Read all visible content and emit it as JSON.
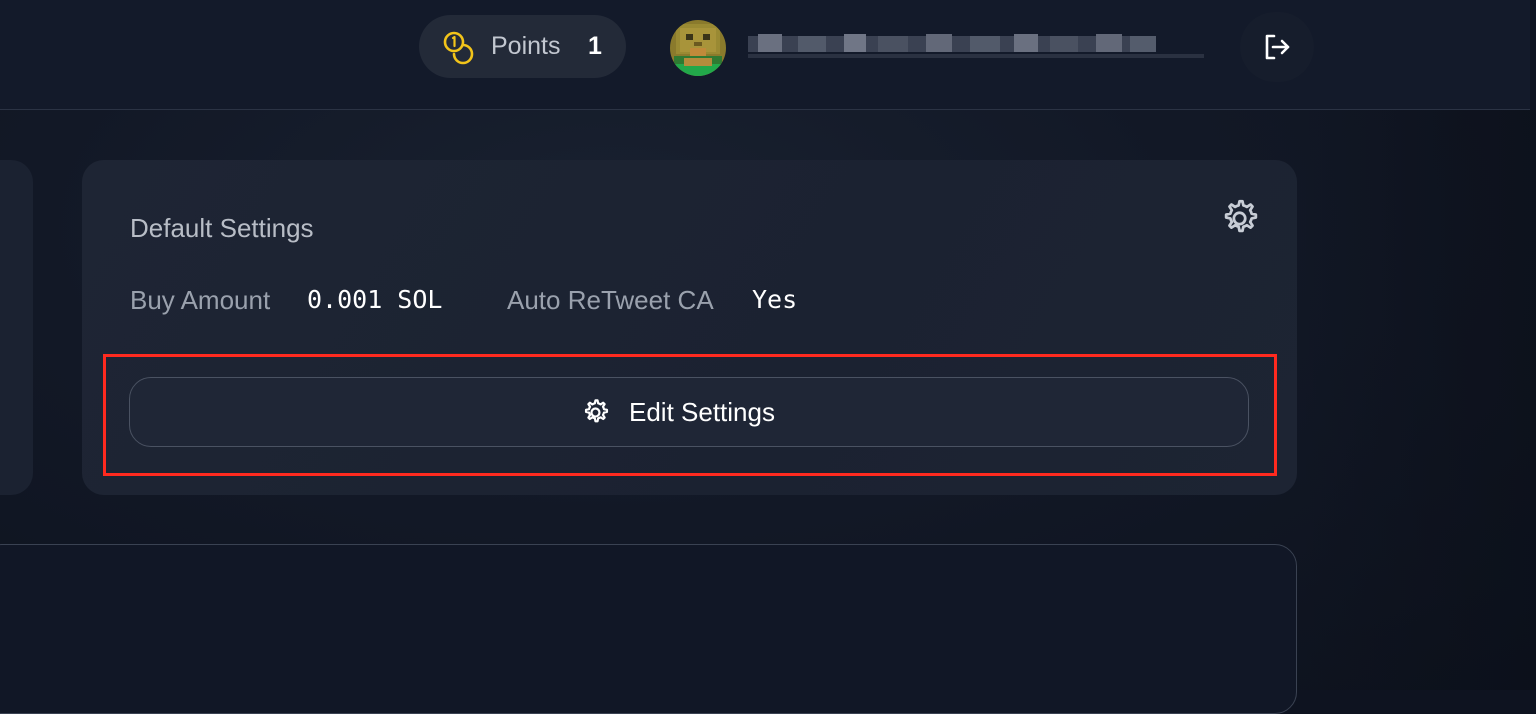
{
  "header": {
    "points_label": "Points",
    "points_value": "1",
    "points_icon": "coins-icon",
    "avatar_icon": "pixel-avatar",
    "username_redacted": true,
    "logout_icon": "logout-icon"
  },
  "settings": {
    "title": "Default Settings",
    "gear_icon": "gear-icon",
    "buy_amount_label": "Buy Amount",
    "buy_amount_value": "0.001 SOL",
    "auto_retweet_label": "Auto ReTweet CA",
    "auto_retweet_value": "Yes",
    "edit_button_label": "Edit Settings",
    "edit_button_icon": "gear-icon"
  },
  "colors": {
    "background": "#0e1320",
    "card": "#1b2231",
    "accent_gold": "#f2c41a",
    "highlight_red": "#ff2a1f"
  }
}
